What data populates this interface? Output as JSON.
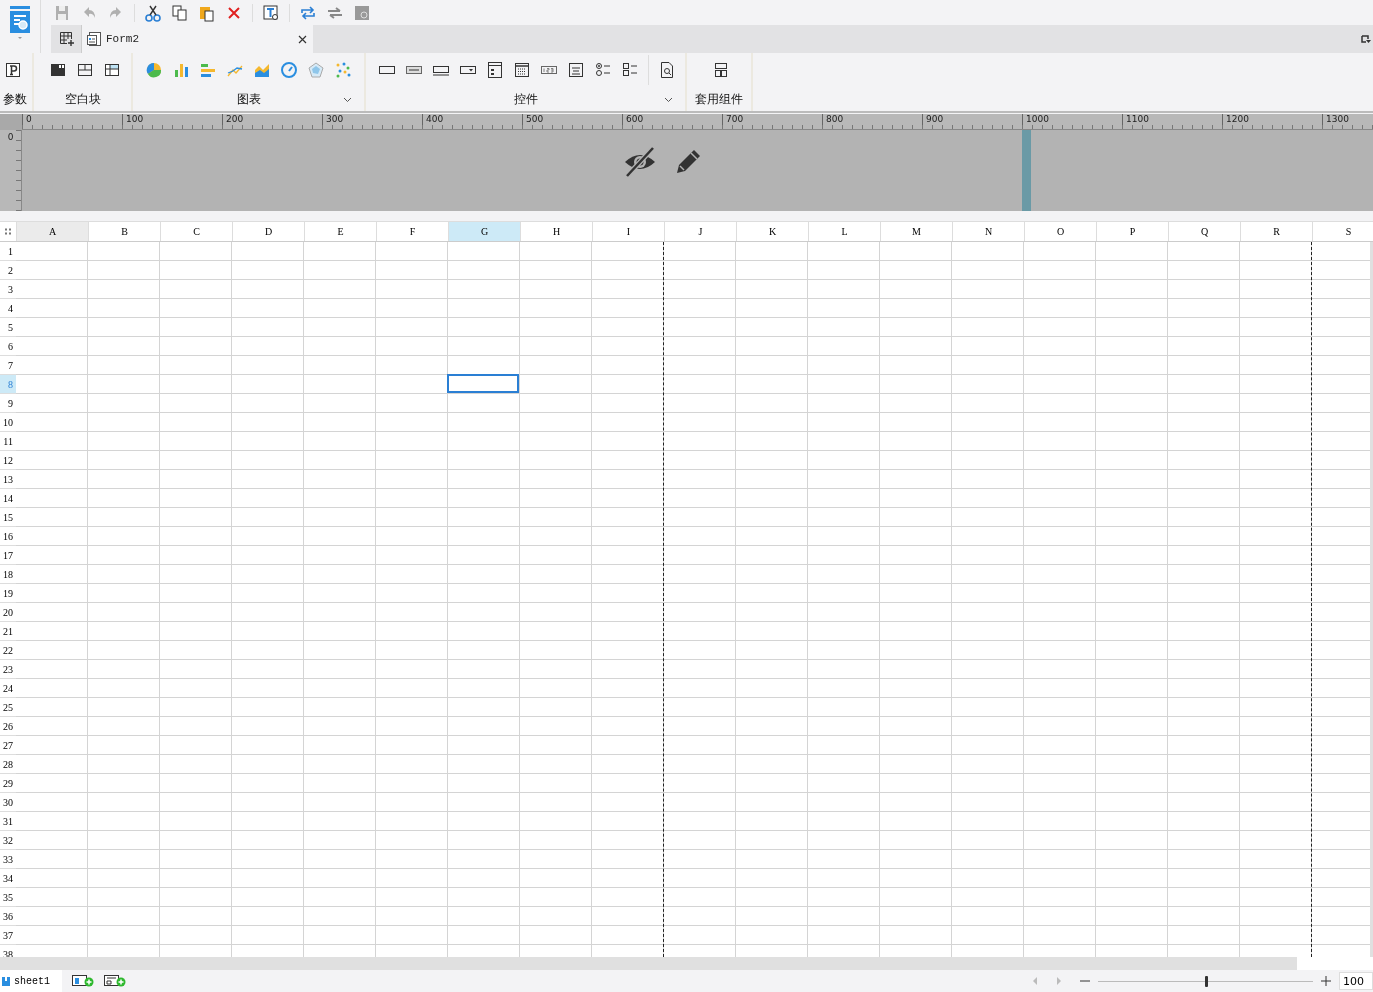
{
  "tabs": [
    {
      "label": "Form2",
      "selected": true
    }
  ],
  "ribbon": {
    "groups": [
      {
        "label": "参数",
        "expandable": false
      },
      {
        "label": "空白块",
        "expandable": false
      },
      {
        "label": "图表",
        "expandable": true
      },
      {
        "label": "控件",
        "expandable": true
      },
      {
        "label": "套用组件",
        "expandable": false
      }
    ]
  },
  "ruler": {
    "labels": [
      "0",
      "100",
      "200",
      "300",
      "400",
      "500",
      "600",
      "700",
      "800",
      "900",
      "1000",
      "1100",
      "1200",
      "1300"
    ],
    "vertical_label": "0"
  },
  "sheet": {
    "columns": [
      {
        "label": "A",
        "selected": false,
        "page_break_after": false
      },
      {
        "label": "B",
        "selected": false,
        "page_break_after": false
      },
      {
        "label": "C",
        "selected": false,
        "page_break_after": false
      },
      {
        "label": "D",
        "selected": false,
        "page_break_after": false
      },
      {
        "label": "E",
        "selected": false,
        "page_break_after": false
      },
      {
        "label": "F",
        "selected": false,
        "page_break_after": false
      },
      {
        "label": "G",
        "selected": true,
        "page_break_after": false
      },
      {
        "label": "H",
        "selected": false,
        "page_break_after": false
      },
      {
        "label": "I",
        "selected": false,
        "page_break_after": true
      },
      {
        "label": "J",
        "selected": false,
        "page_break_after": false
      },
      {
        "label": "K",
        "selected": false,
        "page_break_after": false
      },
      {
        "label": "L",
        "selected": false,
        "page_break_after": false
      },
      {
        "label": "M",
        "selected": false,
        "page_break_after": false
      },
      {
        "label": "N",
        "selected": false,
        "page_break_after": false
      },
      {
        "label": "O",
        "selected": false,
        "page_break_after": false
      },
      {
        "label": "P",
        "selected": false,
        "page_break_after": false
      },
      {
        "label": "Q",
        "selected": false,
        "page_break_after": false
      },
      {
        "label": "R",
        "selected": false,
        "page_break_after": true
      },
      {
        "label": "S",
        "selected": false,
        "page_break_after": false
      }
    ],
    "rows": [
      {
        "label": "1",
        "selected": false
      },
      {
        "label": "2",
        "selected": false
      },
      {
        "label": "3",
        "selected": false
      },
      {
        "label": "4",
        "selected": false
      },
      {
        "label": "5",
        "selected": false
      },
      {
        "label": "6",
        "selected": false
      },
      {
        "label": "7",
        "selected": false
      },
      {
        "label": "8",
        "selected": true
      },
      {
        "label": "9",
        "selected": false
      },
      {
        "label": "10",
        "selected": false
      },
      {
        "label": "11",
        "selected": false
      },
      {
        "label": "12",
        "selected": false
      },
      {
        "label": "13",
        "selected": false
      },
      {
        "label": "14",
        "selected": false
      },
      {
        "label": "15",
        "selected": false
      },
      {
        "label": "16",
        "selected": false
      },
      {
        "label": "17",
        "selected": false
      },
      {
        "label": "18",
        "selected": false
      },
      {
        "label": "19",
        "selected": false
      },
      {
        "label": "20",
        "selected": false
      },
      {
        "label": "21",
        "selected": false
      },
      {
        "label": "22",
        "selected": false
      },
      {
        "label": "23",
        "selected": false
      },
      {
        "label": "24",
        "selected": false
      },
      {
        "label": "25",
        "selected": false
      },
      {
        "label": "26",
        "selected": false
      },
      {
        "label": "27",
        "selected": false
      },
      {
        "label": "28",
        "selected": false
      },
      {
        "label": "29",
        "selected": false
      },
      {
        "label": "30",
        "selected": false
      },
      {
        "label": "31",
        "selected": false
      },
      {
        "label": "32",
        "selected": false
      },
      {
        "label": "33",
        "selected": false
      },
      {
        "label": "34",
        "selected": false
      },
      {
        "label": "35",
        "selected": false
      },
      {
        "label": "36",
        "selected": false
      },
      {
        "label": "37",
        "selected": false
      },
      {
        "label": "38",
        "selected": false
      }
    ]
  },
  "status_bar": {
    "sheet_tabs": [
      {
        "label": "sheet1",
        "selected": true
      }
    ],
    "zoom": {
      "level": 0.5,
      "reading": "100"
    }
  }
}
